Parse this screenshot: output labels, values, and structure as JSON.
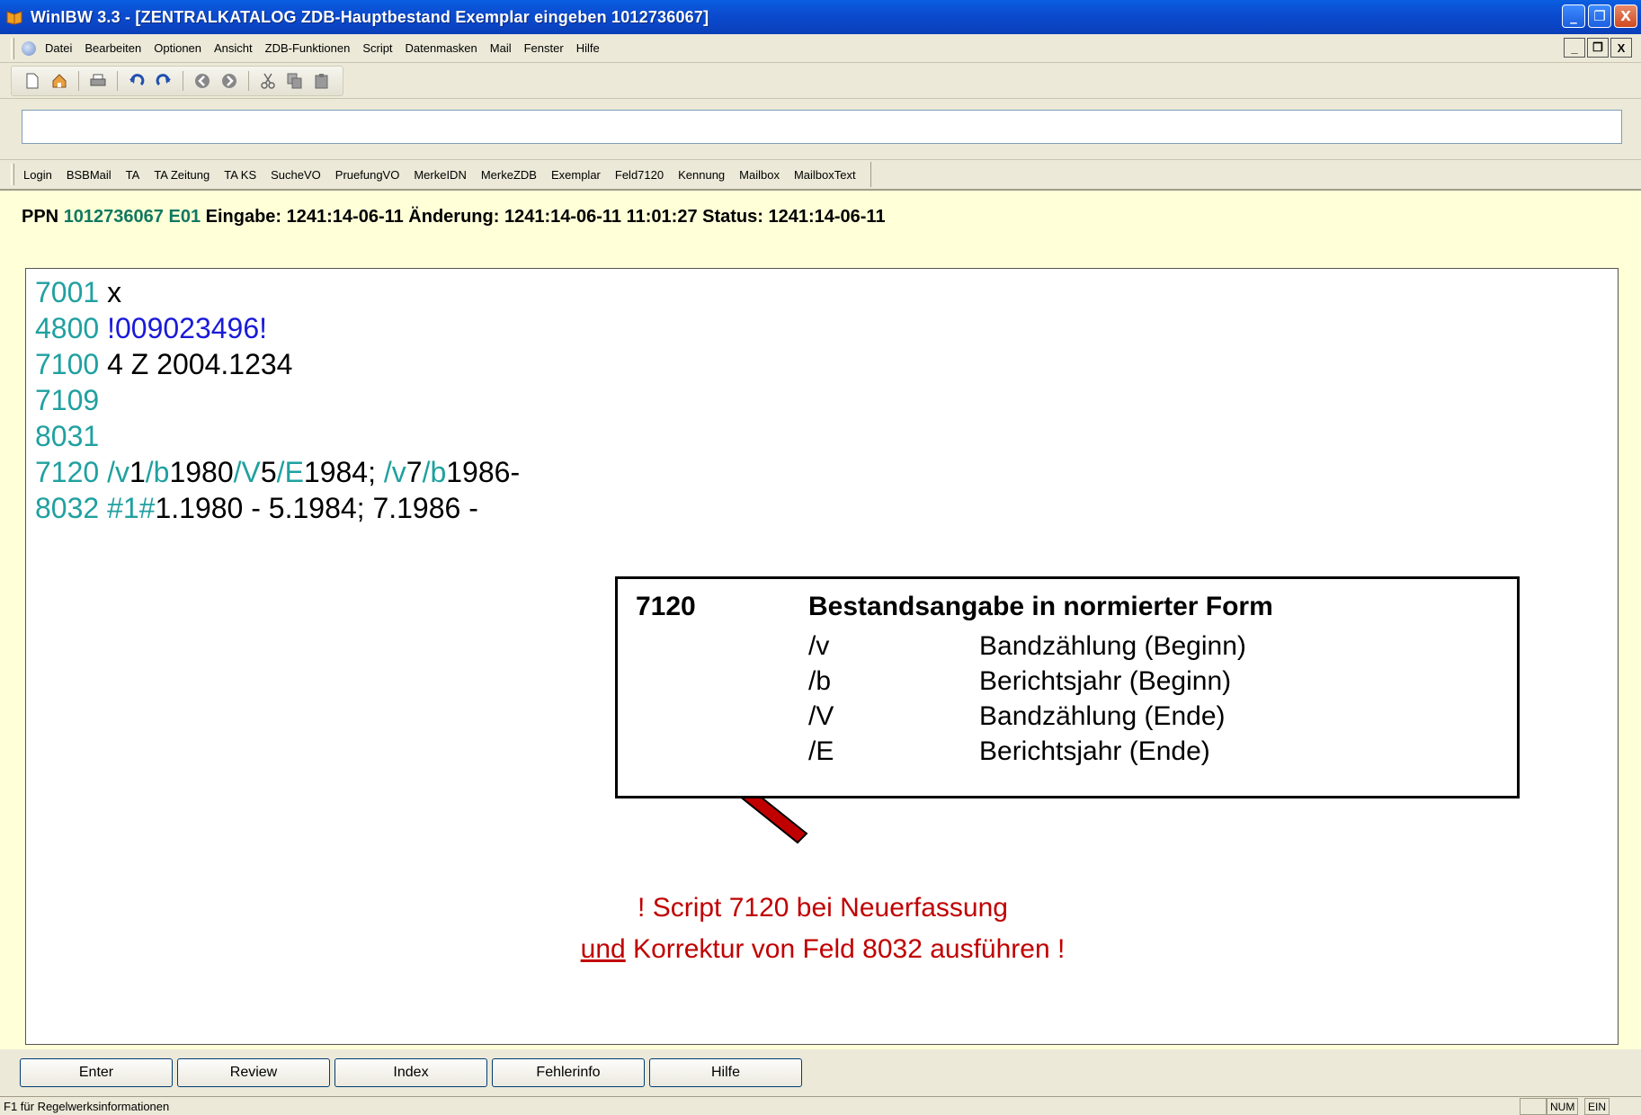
{
  "window": {
    "title": "WinIBW 3.3 - [ZENTRALKATALOG ZDB-Hauptbestand Exemplar eingeben 1012736067]",
    "buttons": [
      "_",
      "❐",
      "X"
    ]
  },
  "menu": {
    "items": [
      "Datei",
      "Bearbeiten",
      "Optionen",
      "Ansicht",
      "ZDB-Funktionen",
      "Script",
      "Datenmasken",
      "Mail",
      "Fenster",
      "Hilfe"
    ]
  },
  "toolbar": {
    "icons": [
      "new-icon",
      "home-icon",
      "print-icon",
      "undo-icon",
      "redo-icon",
      "back-icon",
      "forward-icon",
      "cut-icon",
      "copy-icon",
      "paste-icon"
    ]
  },
  "command": {
    "value": ""
  },
  "shortcuts": [
    "Login",
    "BSBMail",
    "TA",
    "TA Zeitung",
    "TA KS",
    "SucheVO",
    "PruefungVO",
    "MerkeIDN",
    "MerkeZDB",
    "Exemplar",
    "Feld7120",
    "Kennung",
    "Mailbox",
    "MailboxText"
  ],
  "header": {
    "ppn_label": "PPN",
    "ppn_value": "1012736067 E01",
    "rest": "Eingabe: 1241:14-06-11 Änderung: 1241:14-06-11 11:01:27 Status: 1241:14-06-11"
  },
  "record": {
    "l1_tag": "7001",
    "l1_val": " x",
    "l2_tag": "4800",
    "l2_val": " !009023496!",
    "l3_tag": "7100",
    "l3_val": " 4 Z 2004.1234",
    "l4_tag": "7109",
    "l5_tag": "8031",
    "l6_tag": "7120",
    "l6_p1": " /v",
    "l6_p2": "1",
    "l6_p3": "/b",
    "l6_p4": "1980",
    "l6_p5": "/V",
    "l6_p6": "5",
    "l6_p7": "/E",
    "l6_p8": "1984; ",
    "l6_p9": "/v",
    "l6_p10": "7",
    "l6_p11": "/b",
    "l6_p12": "1986-",
    "l7_tag": "8032",
    "l7_p1": " #1#",
    "l7_p2": "1.1980 - 5.1984; 7.1986 -"
  },
  "infobox": {
    "code": "7120",
    "title": "Bestandsangabe in normierter Form",
    "rows": [
      {
        "sub": "/v",
        "desc": "Bandzählung (Beginn)"
      },
      {
        "sub": "/b",
        "desc": "Berichtsjahr (Beginn)"
      },
      {
        "sub": "/V",
        "desc": "Bandzählung (Ende)"
      },
      {
        "sub": "/E",
        "desc": "Berichtsjahr (Ende)"
      }
    ]
  },
  "note": {
    "line1": "! Script 7120 bei Neuerfassung",
    "line2_u": "und",
    "line2_rest": " Korrektur von Feld 8032 ausführen !"
  },
  "buttons": [
    "Enter",
    "Review",
    "Index",
    "Fehlerinfo",
    "Hilfe"
  ],
  "status": {
    "message": "F1 für Regelwerksinformationen",
    "num": "NUM",
    "ein": "EIN"
  },
  "colors": {
    "tag": "#20a0a0",
    "ppn": "#107860",
    "link": "#1a1ad8",
    "note": "#c00000",
    "arrow": "#c00000"
  }
}
